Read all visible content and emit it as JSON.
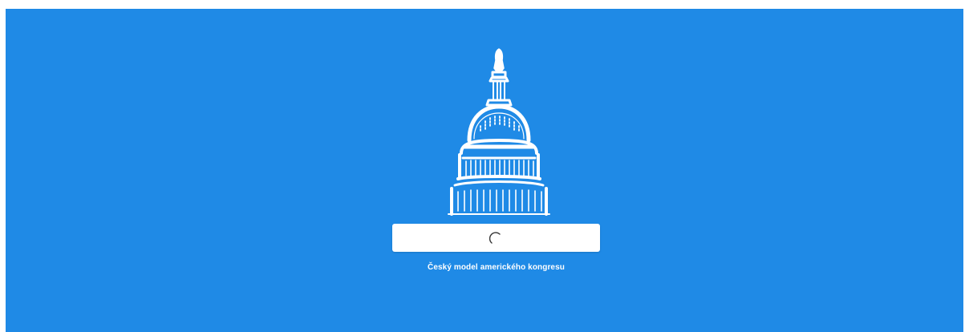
{
  "app": {
    "caption": "Český model amerického kongresu",
    "background_color": "#1f8ae6",
    "logo_icon": "capitol-dome-icon",
    "button_state": "loading",
    "spinner_icon": "loading-spinner-icon"
  }
}
